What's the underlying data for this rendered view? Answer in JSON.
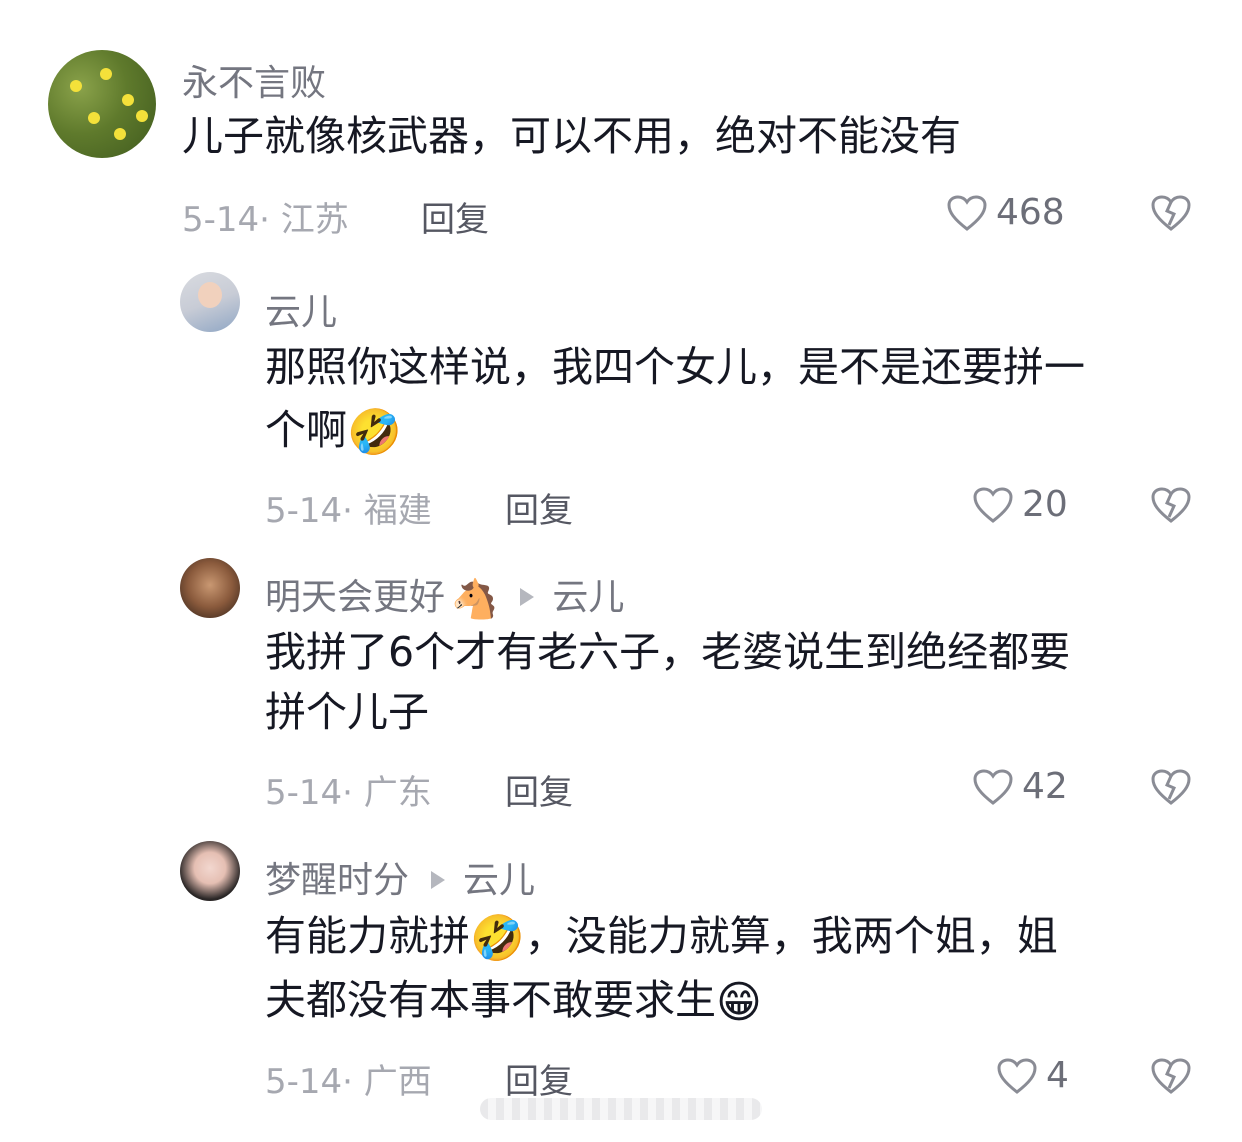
{
  "comments": [
    {
      "username": "永不言败",
      "lines": [
        "儿子就像核武器，可以不用，绝对不能没有"
      ],
      "date_location": "5-14· 江苏",
      "reply_label": "回复",
      "likes": "468"
    },
    {
      "username": "云儿",
      "lines": [
        "那照你这样说，我四个女儿，是不是还要拼一",
        "个啊"
      ],
      "line2_emoji": "🤣",
      "date_location": "5-14· 福建",
      "reply_label": "回复",
      "likes": "20"
    },
    {
      "username": "明天会更好",
      "username_emoji": "🐴",
      "reply_to": "云儿",
      "lines": [
        "我拼了6个才有老六子，老婆说生到绝经都要",
        "拼个儿子"
      ],
      "date_location": "5-14· 广东",
      "reply_label": "回复",
      "likes": "42"
    },
    {
      "username": "梦醒时分",
      "reply_to": "云儿",
      "line1_part1": "有能力就拼",
      "line1_emoji": "🤣",
      "line1_part2": "，没能力就算，我两个姐，姐",
      "line2": "夫都没有本事不敢要求生",
      "line2_emoji": "😁",
      "date_location": "5-14· 广西",
      "reply_label": "回复",
      "likes": "4"
    }
  ],
  "icons": {
    "like": "heart-outline-icon",
    "dislike": "broken-heart-icon",
    "reply_arrow": "triangle-right-icon"
  }
}
